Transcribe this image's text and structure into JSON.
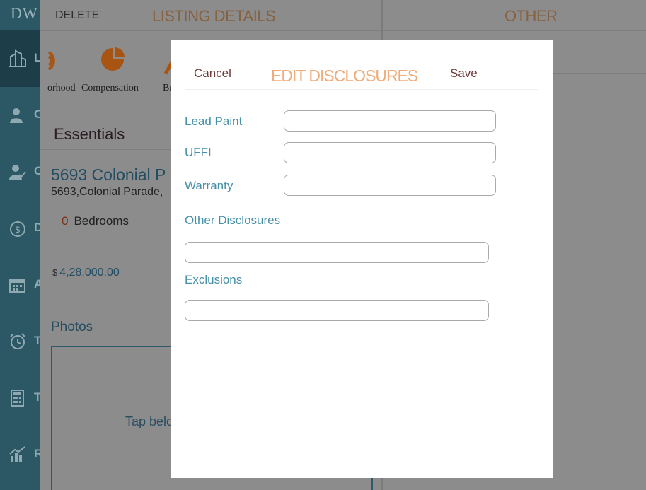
{
  "app": {
    "logo": "DW"
  },
  "sidebar": {
    "items": [
      {
        "icon": "building-icon",
        "label": "L"
      },
      {
        "icon": "person-icon",
        "label": "C"
      },
      {
        "icon": "person-check-icon",
        "label": "C"
      },
      {
        "icon": "money-bag-icon",
        "label": "D"
      },
      {
        "icon": "calendar-icon",
        "label": "A"
      },
      {
        "icon": "alarm-clock-icon",
        "label": "T"
      },
      {
        "icon": "calculator-icon",
        "label": "To"
      },
      {
        "icon": "bar-chart-icon",
        "label": "R"
      }
    ]
  },
  "listing": {
    "delete_label": "DELETE",
    "title": "LISTING DETAILS",
    "tabs": [
      {
        "label": "orhood",
        "icon": "signal-icon"
      },
      {
        "label": "Compensation",
        "icon": "pie-chart-icon"
      },
      {
        "label": "Br",
        "icon": "roof-icon"
      }
    ],
    "section_title": "Essentials",
    "address_line1": "5693 Colonial P",
    "address_line2": "5693,Colonial Parade,",
    "bedrooms_count": "0",
    "bedrooms_label": "Bedrooms",
    "price_currency": "$",
    "price": "4,28,000.00",
    "photos_title": "Photos",
    "photos_hint": "Tap belo"
  },
  "other_panel": {
    "title": "OTHER"
  },
  "modal": {
    "title": "EDIT DISCLOSURES",
    "cancel_label": "Cancel",
    "save_label": "Save",
    "fields": {
      "lead_paint": {
        "label": "Lead Paint",
        "value": ""
      },
      "uffi": {
        "label": "UFFI",
        "value": ""
      },
      "warranty": {
        "label": "Warranty",
        "value": ""
      },
      "other_disclosures": {
        "label": "Other Disclosures",
        "value": ""
      },
      "exclusions": {
        "label": "Exclusions",
        "value": ""
      }
    }
  },
  "colors": {
    "sidebar_bg": "#2c5865",
    "accent_orange": "#d2691e",
    "modal_title": "#f0ac7a",
    "field_label": "#4690a8",
    "modal_button": "#6d3b3b"
  }
}
